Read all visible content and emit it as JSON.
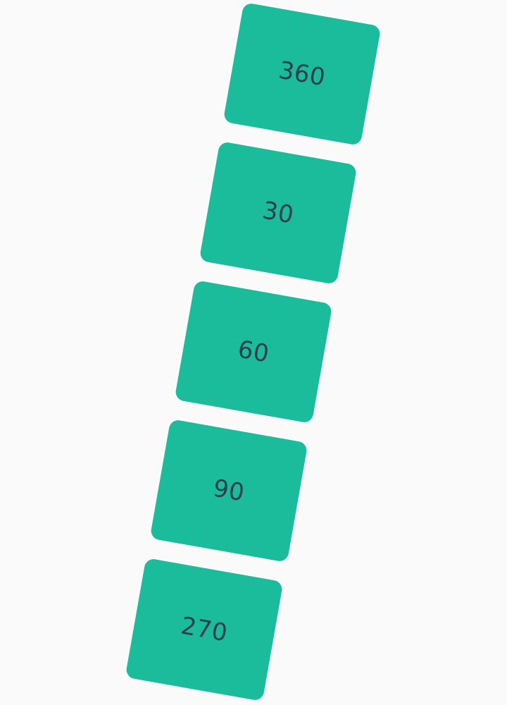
{
  "colors": {
    "background": "#fafafa",
    "tile_fill": "#1abc9c",
    "label_text": "#2c3e50"
  },
  "tiles": [
    {
      "label": "360"
    },
    {
      "label": "30"
    },
    {
      "label": "60"
    },
    {
      "label": "90"
    },
    {
      "label": "270"
    }
  ]
}
